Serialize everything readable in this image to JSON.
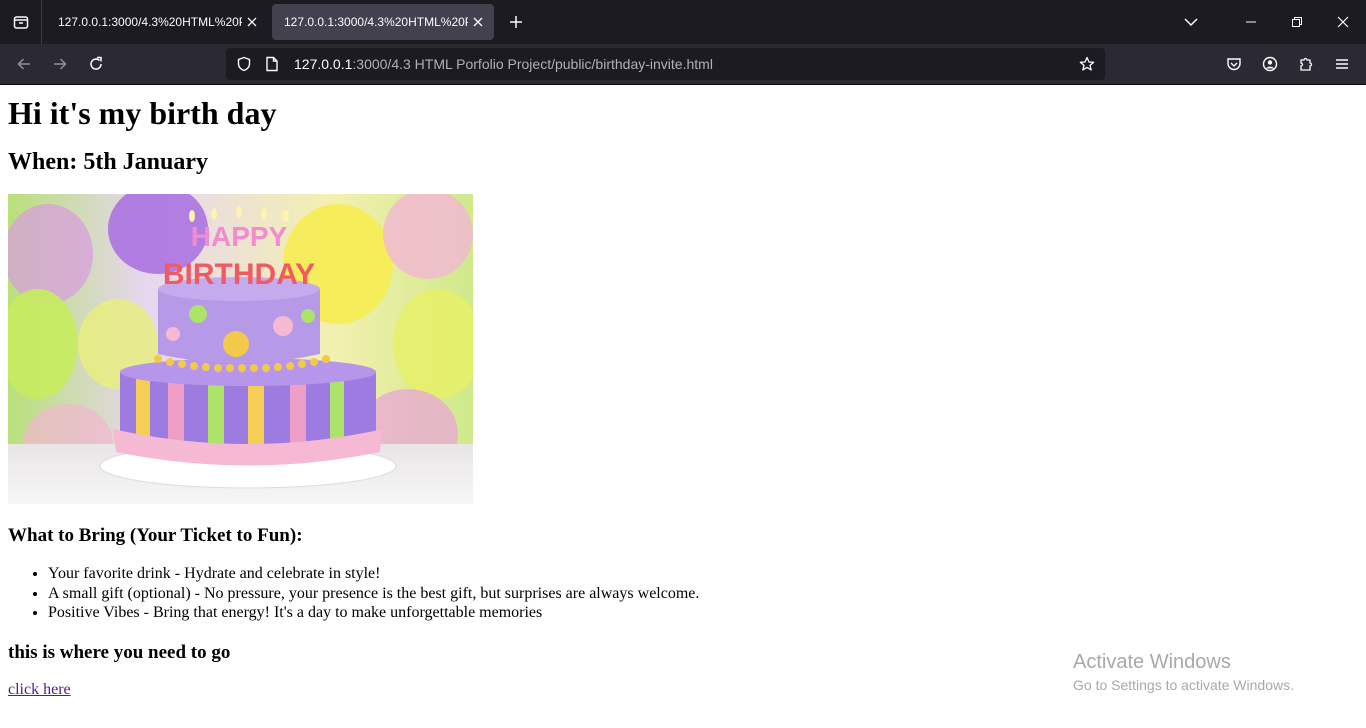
{
  "browser": {
    "tabs": [
      {
        "title": "127.0.0.1:3000/4.3%20HTML%20Porfolio",
        "active": false
      },
      {
        "title": "127.0.0.1:3000/4.3%20HTML%20Porfolio",
        "active": true
      }
    ],
    "url_host": "127.0.0.1",
    "url_path": ":3000/4.3 HTML Porfolio Project/public/birthday-invite.html"
  },
  "page": {
    "heading": "Hi it's my birth day",
    "when": "When: 5th January",
    "image_alt": "Happy Birthday cake",
    "image_text": "HAPPY BIRTHDAY",
    "bring_heading": "What to Bring (Your Ticket to Fun):",
    "bring_items": [
      "Your favorite drink - Hydrate and celebrate in style!",
      "A small gift (optional) - No pressure, your presence is the best gift, but surprises are always welcome.",
      "Positive Vibes - Bring that energy! It's a day to make unforgettable memories"
    ],
    "go_heading": "this is where you need to go",
    "link_text": "click here"
  },
  "watermark": {
    "line1": "Activate Windows",
    "line2": "Go to Settings to activate Windows."
  },
  "colors": {
    "tabbar_bg": "#1c1b22",
    "navbar_bg": "#2b2a33",
    "visited_link": "#551a8b"
  }
}
